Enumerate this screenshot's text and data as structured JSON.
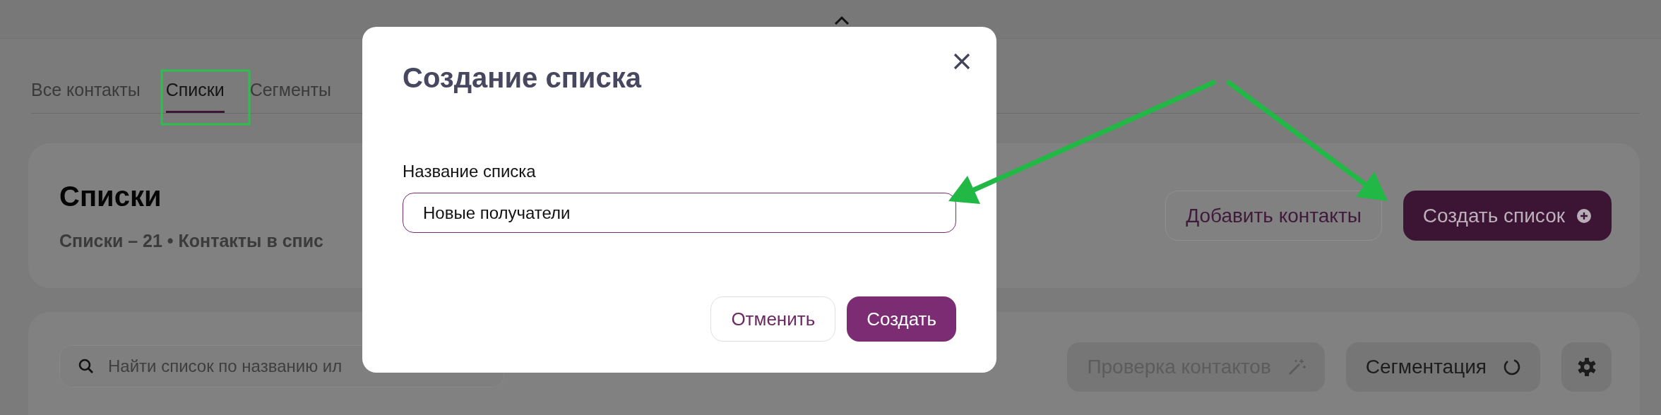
{
  "tabs": [
    {
      "label": "Все контакты",
      "selected": false
    },
    {
      "label": "Списки",
      "selected": true
    },
    {
      "label": "Сегменты",
      "selected": false
    }
  ],
  "header_card": {
    "title": "Списки",
    "summary": "Списки – 21 • Контакты в спис",
    "buttons": [
      {
        "label": "Добавить контакты",
        "kind": "secondary"
      },
      {
        "label": "Создать список",
        "kind": "primary"
      }
    ]
  },
  "toolbar": {
    "search": {
      "placeholder": "Найти список по названию ил"
    },
    "buttons": [
      {
        "label": "Проверка контактов",
        "kind": "wand",
        "disabled": true
      },
      {
        "label": "Сегментация",
        "kind": "segment",
        "disabled": false
      },
      {
        "kind": "settings",
        "disabled": false
      }
    ]
  },
  "modal": {
    "title": "Создание списка",
    "field": {
      "label": "Название списка",
      "value": "Новые получатели"
    },
    "buttons": [
      {
        "label": "Отменить",
        "kind": "secondary"
      },
      {
        "label": "Создать",
        "kind": "primary"
      }
    ]
  }
}
